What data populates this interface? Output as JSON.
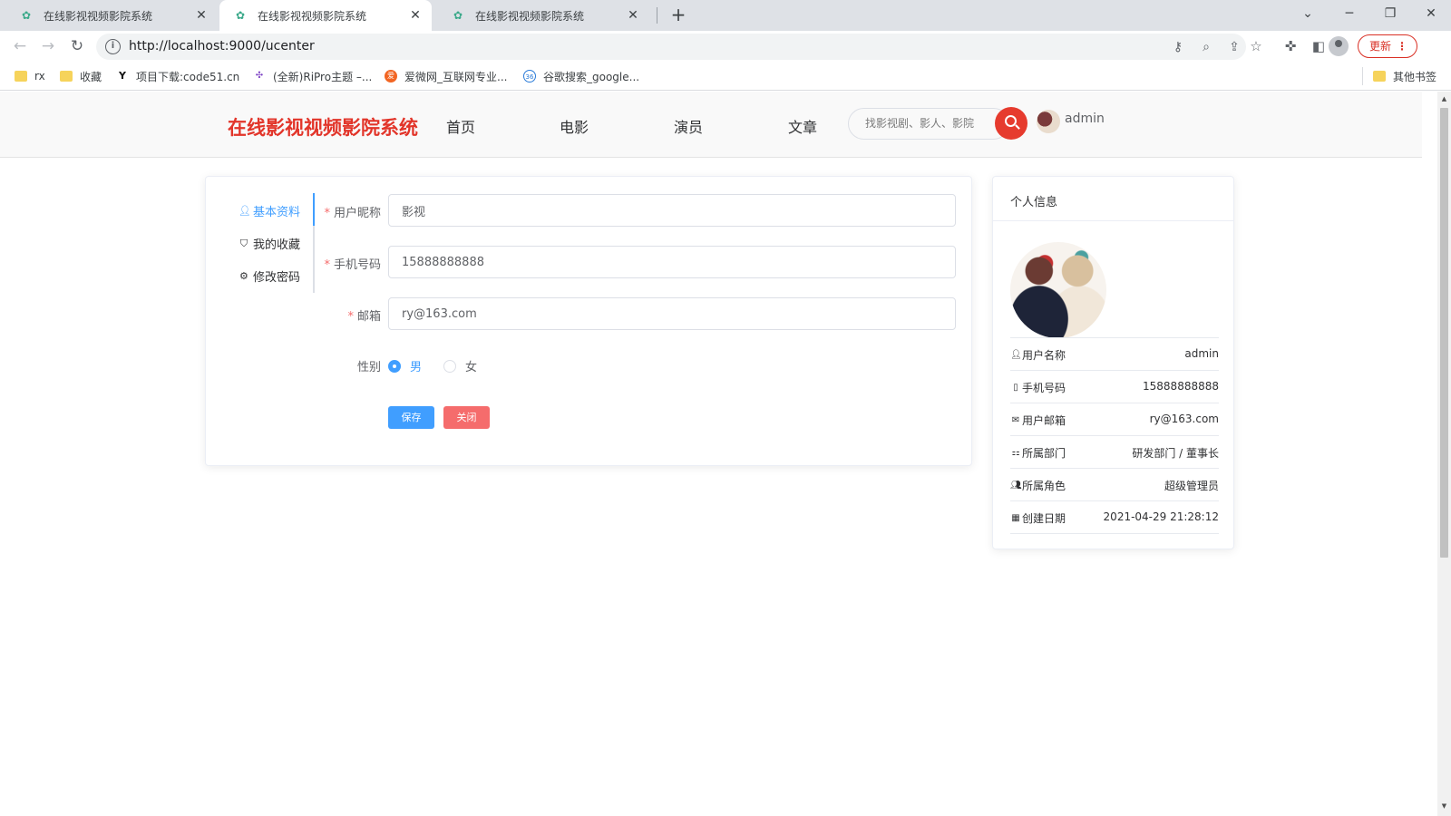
{
  "browser": {
    "tabs": [
      {
        "title": "在线影视视频影院系统",
        "active": false
      },
      {
        "title": "在线影视视频影院系统",
        "active": true
      },
      {
        "title": "在线影视视频影院系统",
        "active": false
      }
    ],
    "url": "http://localhost:9000/ucenter",
    "update_label": "更新",
    "bookmarks": [
      {
        "label": "rx",
        "icon": "folder-icon"
      },
      {
        "label": "收藏",
        "icon": "folder-icon"
      },
      {
        "label": "项目下载:code51.cn",
        "icon": "y-logo-icon"
      },
      {
        "label": "(全新)RiPro主题 –...",
        "icon": "ripro-icon"
      },
      {
        "label": "爱微网_互联网专业...",
        "icon": "aiwei-icon"
      },
      {
        "label": "谷歌搜索_google...",
        "icon": "360-icon"
      }
    ],
    "other_bookmarks": "其他书签"
  },
  "site": {
    "brand": "在线影视视频影院系统",
    "nav": [
      "首页",
      "电影",
      "演员",
      "文章"
    ],
    "search_placeholder": "找影视剧、影人、影院",
    "username": "admin"
  },
  "profile": {
    "menu": [
      {
        "label": "基本资料",
        "icon": "user-icon",
        "active": true
      },
      {
        "label": "我的收藏",
        "icon": "bookmark-icon",
        "active": false
      },
      {
        "label": "修改密码",
        "icon": "gear-icon",
        "active": false
      }
    ],
    "form": {
      "nickname_label": "用户昵称",
      "nickname_value": "影视",
      "phone_label": "手机号码",
      "phone_value": "15888888888",
      "email_label": "邮箱",
      "email_value": "ry@163.com",
      "gender_label": "性别",
      "gender_options": [
        "男",
        "女"
      ],
      "gender_selected": "男",
      "save_label": "保存",
      "close_label": "关闭"
    },
    "info": {
      "title": "个人信息",
      "rows": [
        {
          "key": "用户名称",
          "value": "admin",
          "icon": "user-icon"
        },
        {
          "key": "手机号码",
          "value": "15888888888",
          "icon": "phone-icon"
        },
        {
          "key": "用户邮箱",
          "value": "ry@163.com",
          "icon": "mail-icon"
        },
        {
          "key": "所属部门",
          "value": "研发部门 / 董事长",
          "icon": "tree-icon"
        },
        {
          "key": "所属角色",
          "value": "超级管理员",
          "icon": "peoples-icon"
        },
        {
          "key": "创建日期",
          "value": "2021-04-29 21:28:12",
          "icon": "date-icon"
        }
      ]
    }
  },
  "colors": {
    "brand": "#e2352a",
    "primary": "#409eff",
    "danger": "#f56c6c",
    "search_button": "#e63b2e"
  }
}
